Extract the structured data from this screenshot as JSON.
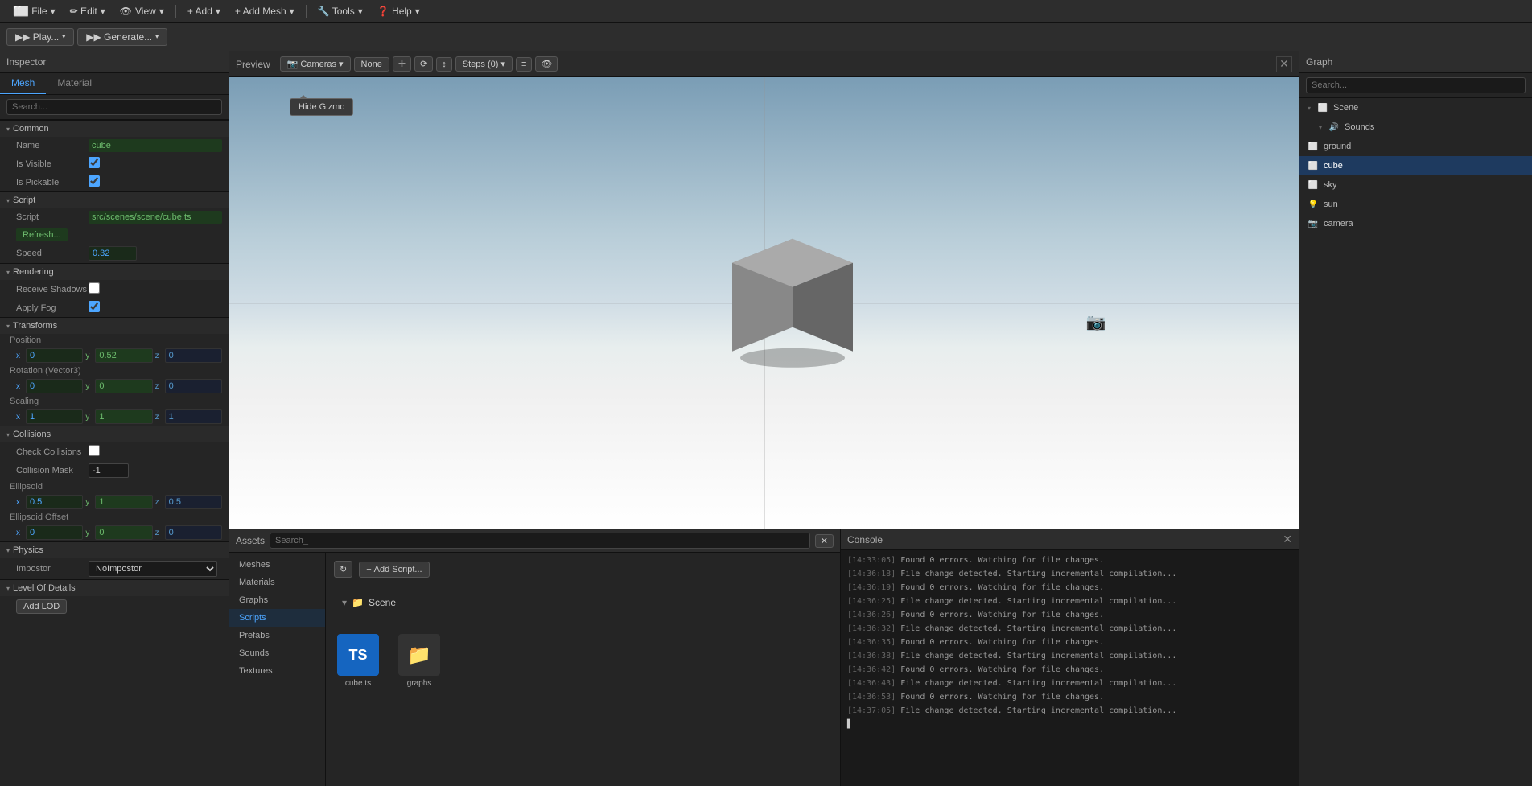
{
  "menubar": {
    "file_label": "⬜ File",
    "edit_label": "✏ Edit",
    "view_label": "👁 View",
    "add_label": "+ Add",
    "add_mesh_label": "+ Add Mesh",
    "tools_label": "🔧 Tools",
    "help_label": "❓ Help"
  },
  "toolbar": {
    "play_label": "▶ Play...",
    "generate_label": "▶ Generate..."
  },
  "inspector": {
    "title": "Inspector",
    "tab_mesh": "Mesh",
    "tab_material": "Material",
    "search_placeholder": "Search...",
    "sections": {
      "common": {
        "label": "Common",
        "name_label": "Name",
        "name_value": "cube",
        "is_visible_label": "Is Visible",
        "is_visible_checked": true,
        "is_pickable_label": "Is Pickable",
        "is_pickable_checked": true
      },
      "script": {
        "label": "Script",
        "script_label": "Script",
        "script_value": "src/scenes/scene/cube.ts",
        "refresh_label": "Refresh...",
        "speed_label": "Speed",
        "speed_value": "0.32"
      },
      "rendering": {
        "label": "Rendering",
        "receive_shadows_label": "Receive Shadows",
        "receive_shadows_checked": false,
        "apply_fog_label": "Apply Fog",
        "apply_fog_checked": true
      },
      "transforms": {
        "label": "Transforms",
        "position_label": "Position",
        "pos_x": "0",
        "pos_y": "0.52",
        "pos_z": "0",
        "rotation_label": "Rotation (Vector3)",
        "rot_x": "0",
        "rot_y": "0",
        "rot_z": "0",
        "scaling_label": "Scaling",
        "scale_x": "1",
        "scale_y": "1",
        "scale_z": "1"
      },
      "collisions": {
        "label": "Collisions",
        "check_collisions_label": "Check Collisions",
        "check_collisions_checked": false,
        "collision_mask_label": "Collision Mask",
        "collision_mask_value": "-1",
        "ellipsoid_label": "Ellipsoid",
        "ell_x": "0.5",
        "ell_y": "1",
        "ell_z": "0.5",
        "ellipsoid_offset_label": "Ellipsoid Offset",
        "ell_off_x": "0",
        "ell_off_y": "0",
        "ell_off_z": "0"
      },
      "physics": {
        "label": "Physics",
        "impostor_label": "Impostor",
        "impostor_value": "NoImpostor"
      },
      "lod": {
        "label": "Level Of Details",
        "add_lod_label": "Add LOD"
      }
    }
  },
  "preview": {
    "title": "Preview",
    "cameras_label": "Cameras",
    "none_label": "None",
    "steps_label": "Steps (0)",
    "tooltip_hide_gizmo": "Hide Gizmo"
  },
  "assets": {
    "title": "Assets",
    "search_placeholder": "Search_",
    "sidebar_items": [
      "Meshes",
      "Materials",
      "Graphs",
      "Scripts",
      "Prefabs",
      "Sounds",
      "Textures"
    ],
    "active_item": "Scripts",
    "add_script_label": "Add Script...",
    "scene_folder_label": "Scene",
    "files": [
      {
        "name": "cube.ts",
        "type": "ts"
      },
      {
        "name": "graphs",
        "type": "folder"
      }
    ]
  },
  "console": {
    "title": "Console",
    "lines": [
      {
        "time": "[14:33:05]",
        "msg": " Found 0 errors. Watching for file changes."
      },
      {
        "time": "[14:36:18]",
        "msg": " File change detected. Starting incremental compilation..."
      },
      {
        "time": "[14:36:19]",
        "msg": " Found 0 errors. Watching for file changes."
      },
      {
        "time": "[14:36:25]",
        "msg": " File change detected. Starting incremental compilation..."
      },
      {
        "time": "[14:36:26]",
        "msg": " Found 0 errors. Watching for file changes."
      },
      {
        "time": "[14:36:32]",
        "msg": " File change detected. Starting incremental compilation..."
      },
      {
        "time": "[14:36:35]",
        "msg": " Found 0 errors. Watching for file changes."
      },
      {
        "time": "[14:36:38]",
        "msg": " File change detected. Starting incremental compilation..."
      },
      {
        "time": "[14:36:42]",
        "msg": " Found 0 errors. Watching for file changes."
      },
      {
        "time": "[14:36:43]",
        "msg": " File change detected. Starting incremental compilation..."
      },
      {
        "time": "[14:36:53]",
        "msg": " Found 0 errors. Watching for file changes."
      },
      {
        "time": "[14:37:05]",
        "msg": " File change detected. Starting incremental compilation..."
      }
    ],
    "cursor": "▌"
  },
  "graph": {
    "title": "Graph",
    "search_placeholder": "Search...",
    "items": [
      {
        "id": "scene",
        "label": "Scene",
        "icon": "⬜",
        "indented": false,
        "expanded": true
      },
      {
        "id": "sounds",
        "label": "Sounds",
        "icon": "🔊",
        "indented": true,
        "expanded": true
      },
      {
        "id": "ground",
        "label": "ground",
        "icon": "⬜",
        "indented": false
      },
      {
        "id": "cube",
        "label": "cube",
        "icon": "⬜",
        "indented": false,
        "active": true
      },
      {
        "id": "sky",
        "label": "sky",
        "icon": "⬜",
        "indented": false
      },
      {
        "id": "sun",
        "label": "sun",
        "icon": "💡",
        "indented": false
      },
      {
        "id": "camera",
        "label": "camera",
        "icon": "📷",
        "indented": false
      }
    ]
  }
}
